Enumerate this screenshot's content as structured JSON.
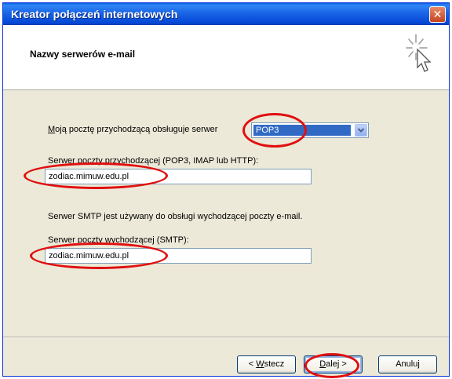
{
  "window": {
    "title": "Kreator połączeń internetowych",
    "close_symbol": "✕"
  },
  "header": {
    "title": "Nazwy serwerów e-mail",
    "icon": "wizard-cursor-icon"
  },
  "incoming_type": {
    "label_accel": "M",
    "label_rest": "oją pocztę przychodzącą obsługuje serwer",
    "selected": "POP3",
    "icon": "chevron-down-icon"
  },
  "incoming_server": {
    "label": "Serwer poczty przychodzącej (POP3, IMAP lub HTTP):",
    "value": "zodiac.mimuw.edu.pl"
  },
  "smtp_info": "Serwer SMTP jest używany do obsługi wychodzącej poczty e-mail.",
  "outgoing_server": {
    "label": "Serwer poczty wychodzącej (SMTP):",
    "value": "zodiac.mimuw.edu.pl"
  },
  "buttons": {
    "back_prefix": "< ",
    "back_accel": "W",
    "back_rest": "stecz",
    "next_accel": "D",
    "next_rest": "alej >",
    "cancel": "Anuluj"
  },
  "colors": {
    "highlight_marks": "#e01010",
    "selection": "#316ac5",
    "titlebar": "#0a5fe8"
  }
}
